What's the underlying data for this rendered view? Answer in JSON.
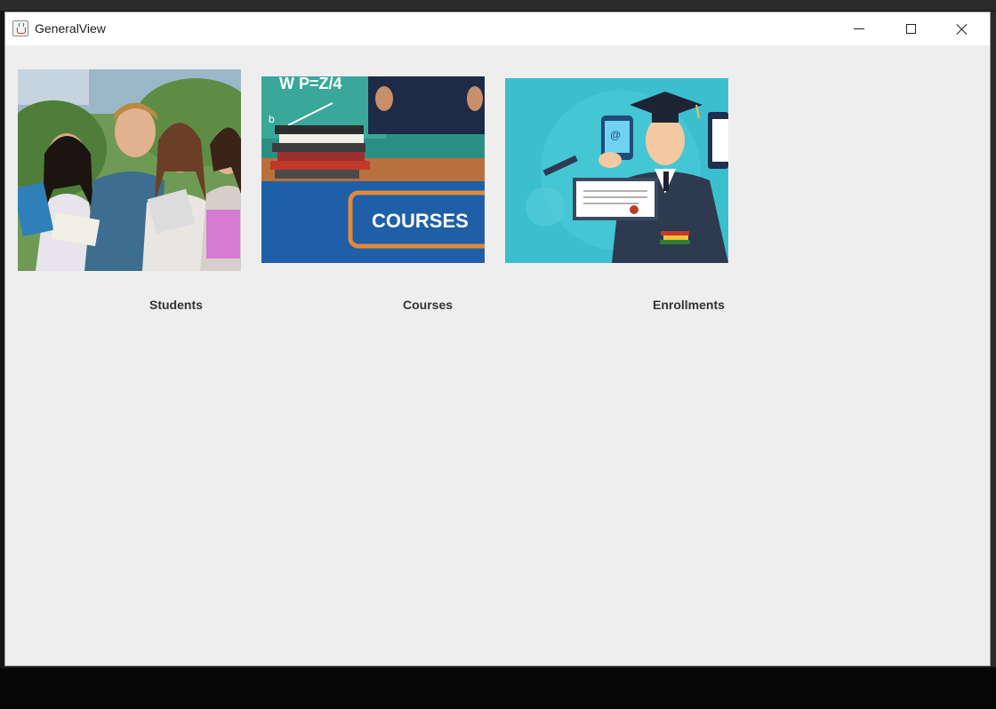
{
  "window": {
    "title": "GeneralView"
  },
  "tiles": [
    {
      "label": "Students"
    },
    {
      "label": "Courses",
      "image_text": "COURSES"
    },
    {
      "label": "Enrollments"
    }
  ],
  "icons": {
    "app": "java-coffee-cup-icon",
    "minimize": "minimize-icon",
    "maximize": "maximize-icon",
    "close": "close-icon"
  },
  "colors": {
    "window_bg": "#eeeeee",
    "titlebar_bg": "#ffffff",
    "courses_blue": "#1f5fa8",
    "courses_orange": "#e08a3c",
    "enrollment_teal": "#3bbfcf"
  }
}
